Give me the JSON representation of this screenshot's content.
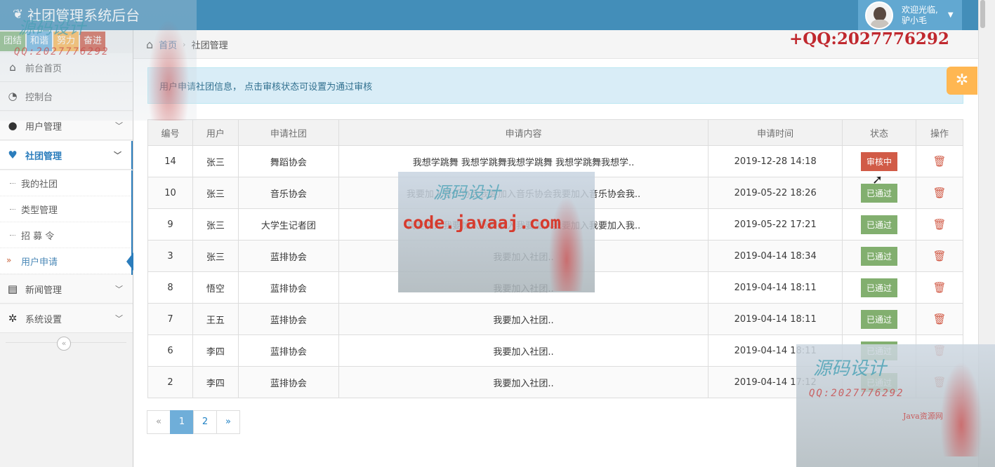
{
  "app": {
    "title": "社团管理系统后台"
  },
  "user": {
    "greeting": "欢迎光临,",
    "name": "驴小毛"
  },
  "shortcuts": [
    {
      "label": "团结",
      "color": "#87b87f"
    },
    {
      "label": "和谐",
      "color": "#6fb3e0"
    },
    {
      "label": "努力",
      "color": "#ffb752"
    },
    {
      "label": "奋进",
      "color": "#d15b47"
    }
  ],
  "sidebar": {
    "items": [
      {
        "label": "前台首页"
      },
      {
        "label": "控制台"
      },
      {
        "label": "用户管理"
      },
      {
        "label": "社团管理"
      },
      {
        "label": "新闻管理"
      },
      {
        "label": "系统设置"
      }
    ],
    "sub": [
      {
        "label": "我的社团"
      },
      {
        "label": "类型管理"
      },
      {
        "label": "招 募 令"
      },
      {
        "label": "用户申请"
      }
    ],
    "collapse_icon": "«"
  },
  "breadcrumb": {
    "home": "首页",
    "current": "社团管理"
  },
  "watermark": {
    "qq_header": "+QQ:2027776292",
    "brand": "源码设计",
    "qq": "QQ:2027776292",
    "code_site": "code.javaaj.com",
    "java_label": "Java资源网"
  },
  "alert": {
    "text": "用户申请社团信息， 点击审核状态可设置为通过审核"
  },
  "table": {
    "headers": [
      "编号",
      "用户",
      "申请社团",
      "申请内容",
      "申请时间",
      "状态",
      "操作"
    ],
    "rows": [
      {
        "id": "14",
        "user": "张三",
        "club": "舞蹈协会",
        "content": "我想学跳舞 我想学跳舞我想学跳舞 我想学跳舞我想学..",
        "time": "2019-12-28 14:18",
        "status": "审核中",
        "state": "pending"
      },
      {
        "id": "10",
        "user": "张三",
        "club": "音乐协会",
        "content": "我要加入音乐协会我要加入音乐协会我要加入音乐协会我..",
        "time": "2019-05-22 18:26",
        "status": "已通过",
        "state": "passed"
      },
      {
        "id": "9",
        "user": "张三",
        "club": "大学生记者团",
        "content": "我要加入我要加入我要加入我要加入我要加入我要加入我..",
        "time": "2019-05-22 17:21",
        "status": "已通过",
        "state": "passed"
      },
      {
        "id": "3",
        "user": "张三",
        "club": "蓝排协会",
        "content": "我要加入社团..",
        "time": "2019-04-14 18:34",
        "status": "已通过",
        "state": "passed"
      },
      {
        "id": "8",
        "user": "悟空",
        "club": "蓝排协会",
        "content": "我要加入社团..",
        "time": "2019-04-14 18:11",
        "status": "已通过",
        "state": "passed"
      },
      {
        "id": "7",
        "user": "王五",
        "club": "蓝排协会",
        "content": "我要加入社团..",
        "time": "2019-04-14 18:11",
        "status": "已通过",
        "state": "passed"
      },
      {
        "id": "6",
        "user": "李四",
        "club": "蓝排协会",
        "content": "我要加入社团..",
        "time": "2019-04-14 18:11",
        "status": "已通过",
        "state": "passed"
      },
      {
        "id": "2",
        "user": "李四",
        "club": "蓝排协会",
        "content": "我要加入社团..",
        "time": "2019-04-14 17:12",
        "status": "已通过",
        "state": "passed"
      }
    ]
  },
  "pagination": {
    "prev": "«",
    "pages": [
      "1",
      "2"
    ],
    "current": "1",
    "next": "»"
  },
  "colors": {
    "navbar": "#438eb9",
    "accent": "#2b7dbc",
    "pending": "#d15b47",
    "passed": "#82af6f",
    "settings": "#ffb752"
  }
}
